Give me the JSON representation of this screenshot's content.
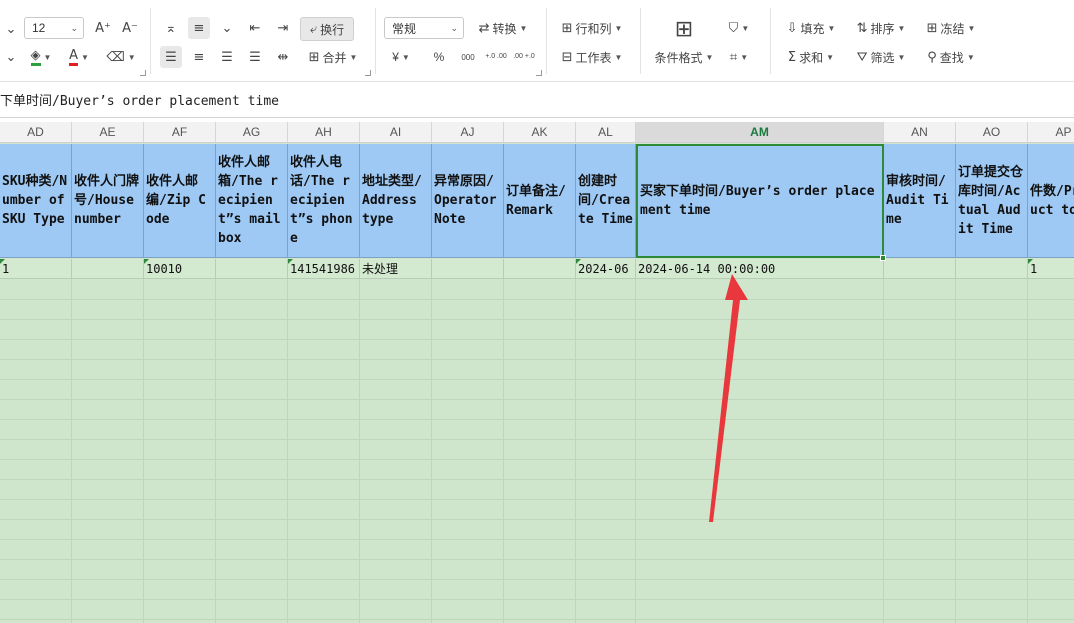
{
  "ribbon": {
    "font_size": "12",
    "wrap_text_label": "换行",
    "merge_label": "合并",
    "number_format": "常规",
    "convert_label": "转换",
    "rows_cols_label": "行和列",
    "worksheet_label": "工作表",
    "conditional_format_label": "条件格式",
    "fill_label": "填充",
    "sort_label": "排序",
    "freeze_label": "冻结",
    "sum_label": "求和",
    "filter_label": "筛选",
    "find_label": "查找",
    "currency_symbol": "¥",
    "percent_symbol": "%",
    "thousands_symbol": "000",
    "inc_decimal": "+.0 .00",
    "dec_decimal": ".00 +.0"
  },
  "formula_bar": {
    "content": "下单时间/Buyer’s order placement time"
  },
  "columns": [
    {
      "letter": "AD",
      "header": "SKU种类/Number of SKU Type",
      "value": "1"
    },
    {
      "letter": "AE",
      "header": "收件人门牌号/House number",
      "value": ""
    },
    {
      "letter": "AF",
      "header": "收件人邮编/Zip Code",
      "value": "10010"
    },
    {
      "letter": "AG",
      "header": "收件人邮箱/The recipient”s mailbox",
      "value": ""
    },
    {
      "letter": "AH",
      "header": "收件人电话/The recipient”s phone",
      "value": "141541986"
    },
    {
      "letter": "AI",
      "header": "地址类型/Address type",
      "value": "未处理"
    },
    {
      "letter": "AJ",
      "header": "异常原因/Operator Note",
      "value": ""
    },
    {
      "letter": "AK",
      "header": "订单备注/Remark",
      "value": ""
    },
    {
      "letter": "AL",
      "header": "创建时间/Create Time",
      "value": "2024-06"
    },
    {
      "letter": "AM",
      "header": "买家下单时间/Buyer’s order placement time",
      "value": "2024-06-14 00:00:00"
    },
    {
      "letter": "AN",
      "header": "审核时间/Audit Time",
      "value": ""
    },
    {
      "letter": "AO",
      "header": "订单提交仓库时间/Actual Audit Time",
      "value": ""
    },
    {
      "letter": "AP",
      "header": "件数/Product tot",
      "value": "1"
    }
  ],
  "colors": {
    "header_fill": "#9ec9f5",
    "data_fill": "#d3e9d0",
    "selection_border": "#2f8a37",
    "annotation_arrow": "#e8383d"
  }
}
